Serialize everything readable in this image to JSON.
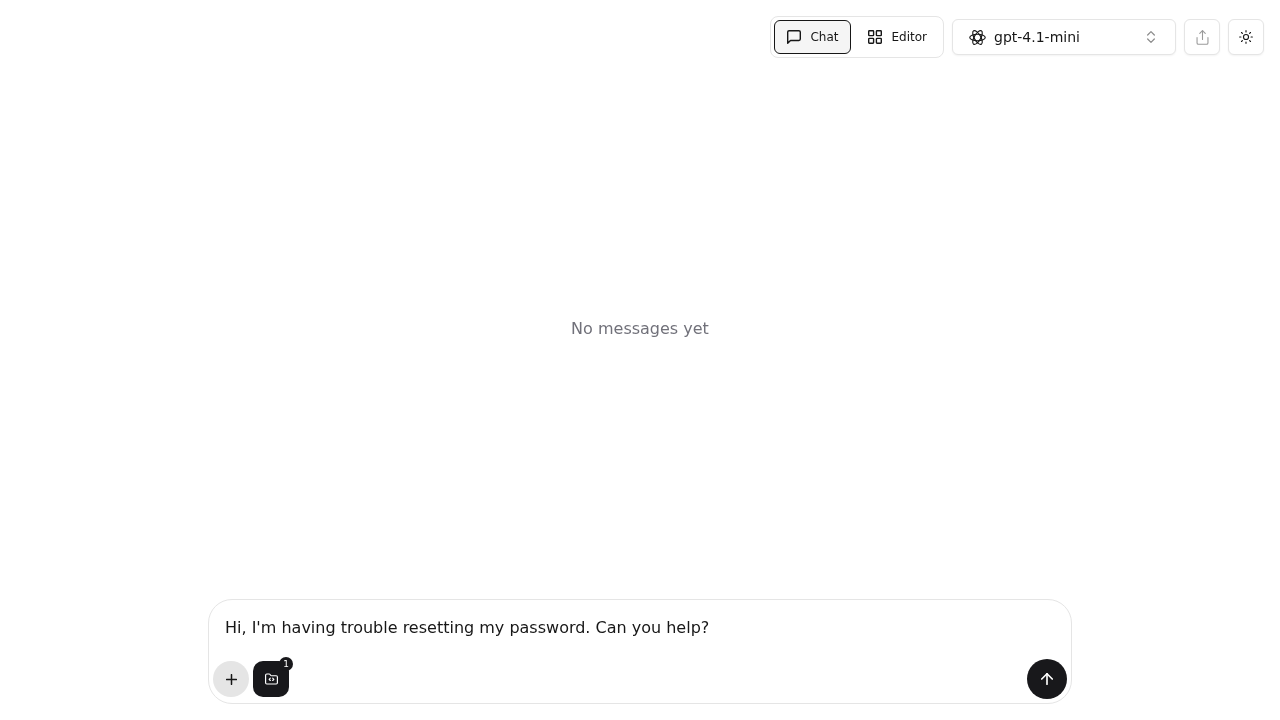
{
  "header": {
    "view_tabs": [
      {
        "label": "Chat",
        "selected": true,
        "kind": "chat"
      },
      {
        "label": "Editor",
        "selected": false,
        "kind": "editor"
      }
    ],
    "model_select": {
      "value": "gpt-4.1-mini"
    }
  },
  "messages": {
    "empty_text": "No messages yet"
  },
  "composer": {
    "value": "Hi, I'm having trouble resetting my password. Can you help?",
    "attachment_count": "1"
  }
}
